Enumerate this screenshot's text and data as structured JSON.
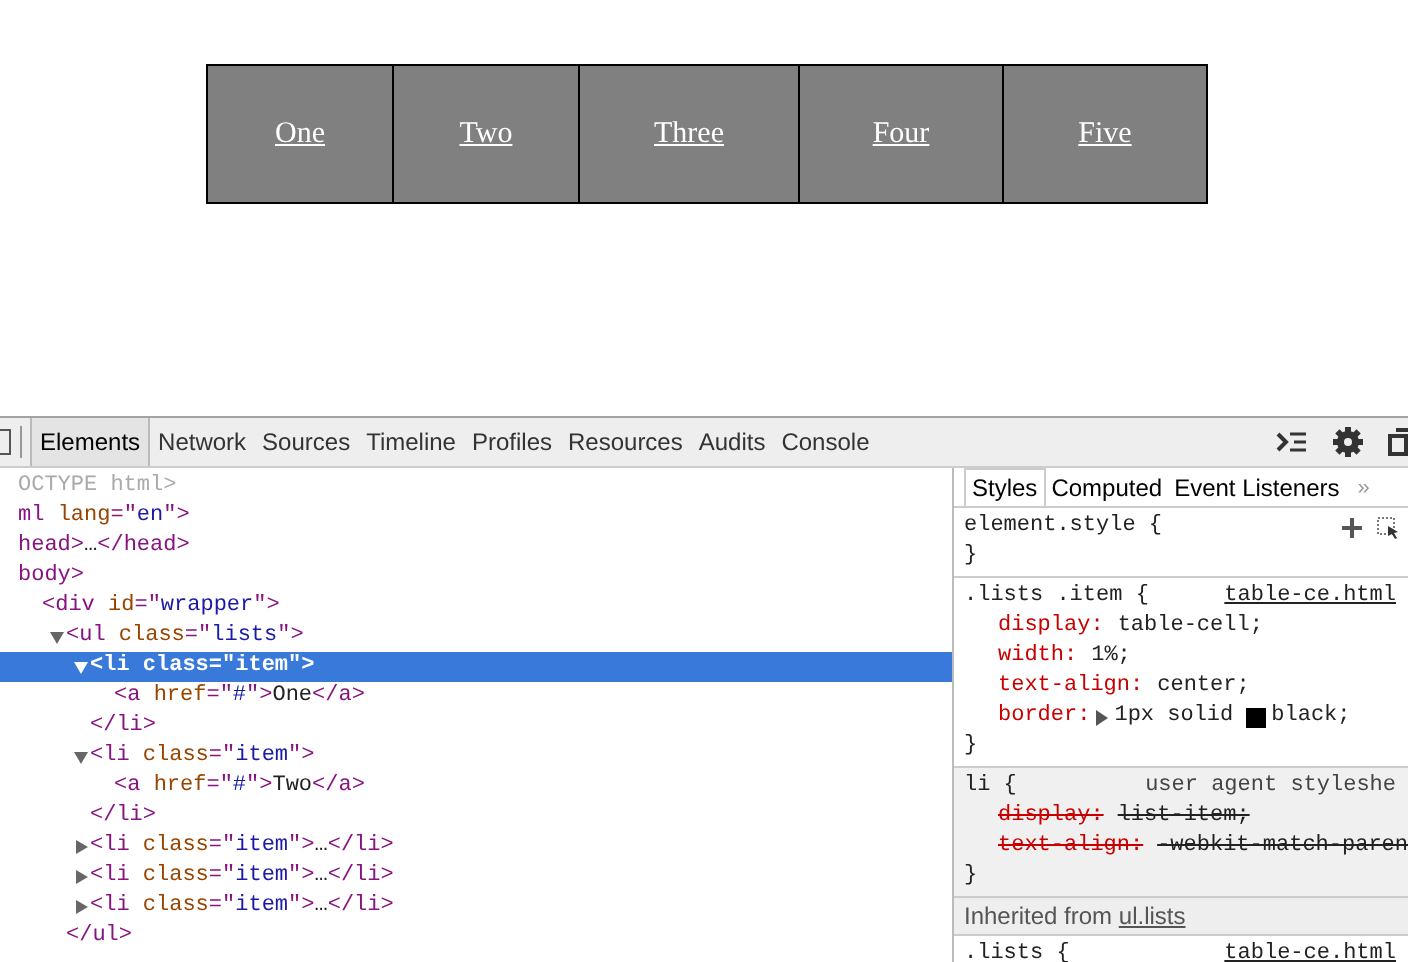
{
  "nav": {
    "items": [
      "One",
      "Two",
      "Three",
      "Four",
      "Five"
    ]
  },
  "devtools": {
    "tabs": [
      {
        "label": "Elements",
        "selected": true
      },
      {
        "label": "Network",
        "selected": false
      },
      {
        "label": "Sources",
        "selected": false
      },
      {
        "label": "Timeline",
        "selected": false
      },
      {
        "label": "Profiles",
        "selected": false
      },
      {
        "label": "Resources",
        "selected": false
      },
      {
        "label": "Audits",
        "selected": false
      },
      {
        "label": "Console",
        "selected": false
      }
    ],
    "dom_tree": [
      {
        "selected": false,
        "segments": [
          {
            "kind": "doctype",
            "text": "OCTYPE html>"
          }
        ]
      },
      {
        "selected": false,
        "segments": [
          {
            "kind": "tag",
            "text": "ml "
          },
          {
            "kind": "attr",
            "text": "lang"
          },
          {
            "kind": "tag",
            "text": "=\""
          },
          {
            "kind": "value",
            "text": "en"
          },
          {
            "kind": "tag",
            "text": "\">"
          }
        ]
      },
      {
        "selected": false,
        "segments": [
          {
            "kind": "tag",
            "text": "head>"
          },
          {
            "kind": "text",
            "text": "…"
          },
          {
            "kind": "tag",
            "text": "</head>"
          }
        ]
      },
      {
        "selected": false,
        "segments": [
          {
            "kind": "tag",
            "text": "body>"
          }
        ],
        "children": [
          {
            "selected": false,
            "segments": [
              {
                "kind": "tag",
                "text": "<div "
              },
              {
                "kind": "attr",
                "text": "id"
              },
              {
                "kind": "tag",
                "text": "=\""
              },
              {
                "kind": "value",
                "text": "wrapper"
              },
              {
                "kind": "tag",
                "text": "\">"
              }
            ],
            "children": [
              {
                "expanded": true,
                "selected": false,
                "segments": [
                  {
                    "kind": "tag",
                    "text": "<ul "
                  },
                  {
                    "kind": "attr",
                    "text": "class"
                  },
                  {
                    "kind": "tag",
                    "text": "=\""
                  },
                  {
                    "kind": "value",
                    "text": "lists"
                  },
                  {
                    "kind": "tag",
                    "text": "\">"
                  }
                ],
                "close": "</ul>",
                "children": [
                  {
                    "expanded": true,
                    "selected": true,
                    "segments": [
                      {
                        "kind": "tag",
                        "text": "<li "
                      },
                      {
                        "kind": "attr",
                        "text": "class"
                      },
                      {
                        "kind": "tag",
                        "text": "=\""
                      },
                      {
                        "kind": "value",
                        "text": "item"
                      },
                      {
                        "kind": "tag",
                        "text": "\">"
                      }
                    ],
                    "close": "</li>",
                    "children": [
                      {
                        "selected": false,
                        "segments": [
                          {
                            "kind": "tag",
                            "text": "<a "
                          },
                          {
                            "kind": "attr",
                            "text": "href"
                          },
                          {
                            "kind": "tag",
                            "text": "=\""
                          },
                          {
                            "kind": "value",
                            "text": "#"
                          },
                          {
                            "kind": "tag",
                            "text": "\">"
                          },
                          {
                            "kind": "text",
                            "text": "One"
                          },
                          {
                            "kind": "tag",
                            "text": "</a>"
                          }
                        ]
                      }
                    ]
                  },
                  {
                    "expanded": true,
                    "selected": false,
                    "segments": [
                      {
                        "kind": "tag",
                        "text": "<li "
                      },
                      {
                        "kind": "attr",
                        "text": "class"
                      },
                      {
                        "kind": "tag",
                        "text": "=\""
                      },
                      {
                        "kind": "value",
                        "text": "item"
                      },
                      {
                        "kind": "tag",
                        "text": "\">"
                      }
                    ],
                    "close": "</li>",
                    "children": [
                      {
                        "selected": false,
                        "segments": [
                          {
                            "kind": "tag",
                            "text": "<a "
                          },
                          {
                            "kind": "attr",
                            "text": "href"
                          },
                          {
                            "kind": "tag",
                            "text": "=\""
                          },
                          {
                            "kind": "value",
                            "text": "#"
                          },
                          {
                            "kind": "tag",
                            "text": "\">"
                          },
                          {
                            "kind": "text",
                            "text": "Two"
                          },
                          {
                            "kind": "tag",
                            "text": "</a>"
                          }
                        ]
                      }
                    ]
                  },
                  {
                    "expanded": false,
                    "selected": false,
                    "segments": [
                      {
                        "kind": "tag",
                        "text": "<li "
                      },
                      {
                        "kind": "attr",
                        "text": "class"
                      },
                      {
                        "kind": "tag",
                        "text": "=\""
                      },
                      {
                        "kind": "value",
                        "text": "item"
                      },
                      {
                        "kind": "tag",
                        "text": "\">"
                      },
                      {
                        "kind": "text",
                        "text": "…"
                      },
                      {
                        "kind": "tag",
                        "text": "</li>"
                      }
                    ]
                  },
                  {
                    "expanded": false,
                    "selected": false,
                    "segments": [
                      {
                        "kind": "tag",
                        "text": "<li "
                      },
                      {
                        "kind": "attr",
                        "text": "class"
                      },
                      {
                        "kind": "tag",
                        "text": "=\""
                      },
                      {
                        "kind": "value",
                        "text": "item"
                      },
                      {
                        "kind": "tag",
                        "text": "\">"
                      },
                      {
                        "kind": "text",
                        "text": "…"
                      },
                      {
                        "kind": "tag",
                        "text": "</li>"
                      }
                    ]
                  },
                  {
                    "expanded": false,
                    "selected": false,
                    "segments": [
                      {
                        "kind": "tag",
                        "text": "<li "
                      },
                      {
                        "kind": "attr",
                        "text": "class"
                      },
                      {
                        "kind": "tag",
                        "text": "=\""
                      },
                      {
                        "kind": "value",
                        "text": "item"
                      },
                      {
                        "kind": "tag",
                        "text": "\">"
                      },
                      {
                        "kind": "text",
                        "text": "…"
                      },
                      {
                        "kind": "tag",
                        "text": "</li>"
                      }
                    ]
                  }
                ]
              }
            ]
          }
        ]
      }
    ],
    "styles_tabs": [
      {
        "label": "Styles",
        "selected": true
      },
      {
        "label": "Computed",
        "selected": false
      },
      {
        "label": "Event Listeners",
        "selected": false
      }
    ],
    "styles_more": "»",
    "rules": [
      {
        "kind": "element",
        "selector": "element.style {",
        "close": "}"
      },
      {
        "kind": "author",
        "selector": ".lists .item {",
        "source": "table-ce.html",
        "close": "}",
        "properties": [
          {
            "name": "display:",
            "value": "table-cell;",
            "overridden": false
          },
          {
            "name": "width:",
            "value": "1%;",
            "overridden": false
          },
          {
            "name": "text-align:",
            "value": "center;",
            "overridden": false
          },
          {
            "name": "border:",
            "value": "1px solid",
            "expandable": true,
            "color": "#000000",
            "value_after": "black;",
            "overridden": false
          }
        ]
      },
      {
        "kind": "agent",
        "selector": "li {",
        "source": "user agent styleshe",
        "close": "}",
        "properties": [
          {
            "name": "display:",
            "value": "list-item;",
            "overridden": true
          },
          {
            "name": "text-align:",
            "value": "-webkit-match-paren",
            "overridden": true
          }
        ]
      },
      {
        "kind": "inherited",
        "label": "Inherited from",
        "link": "ul.lists"
      },
      {
        "kind": "author",
        "selector": ".lists {",
        "source": "table-ce.html"
      }
    ]
  }
}
